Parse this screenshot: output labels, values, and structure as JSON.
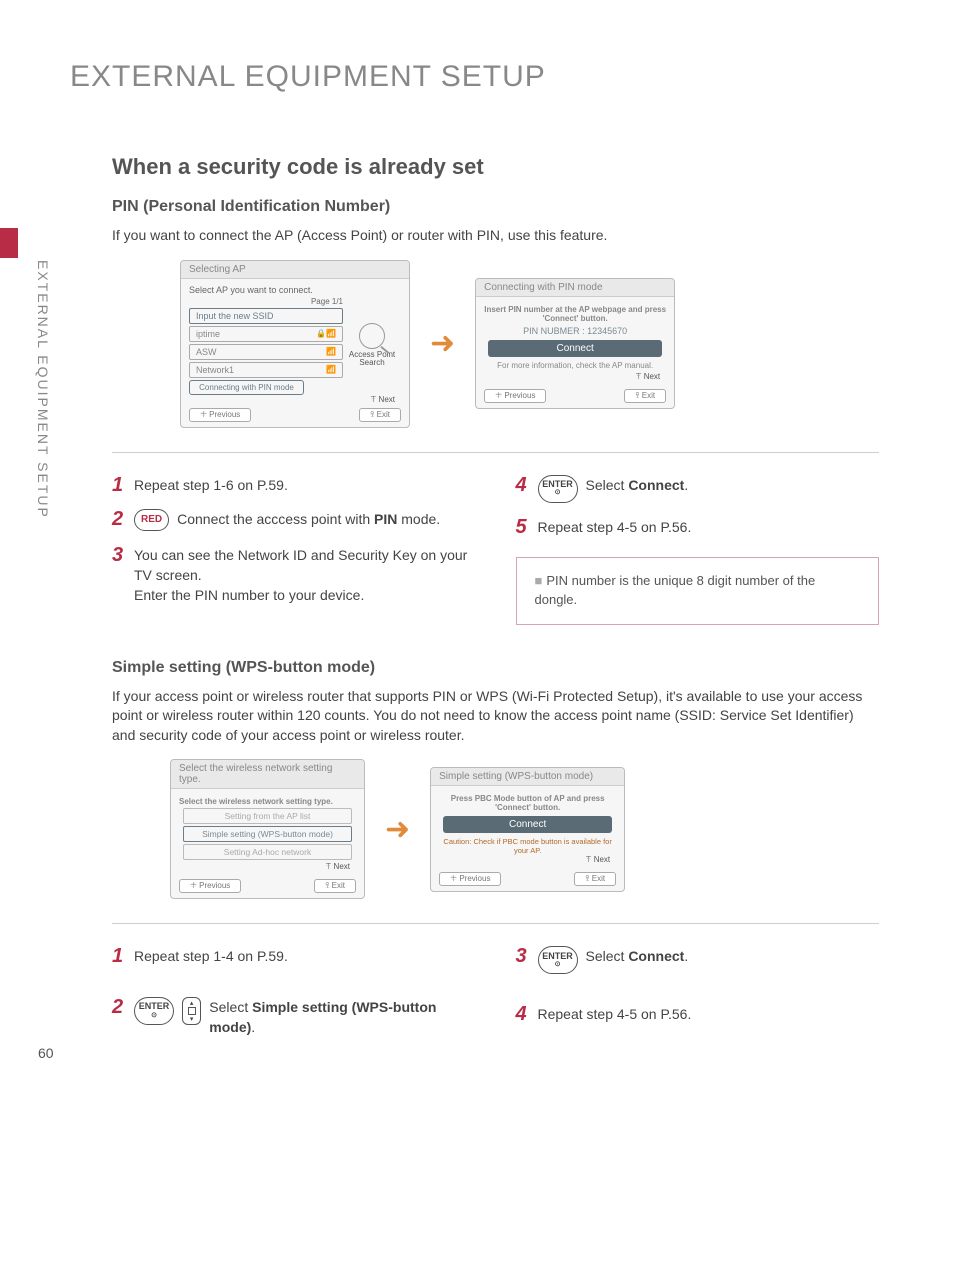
{
  "accentColor": "#b82c45",
  "sideLabel": "EXTERNAL EQUIPMENT SETUP",
  "pageNumber": "60",
  "mainTitle": "EXTERNAL EQUIPMENT SETUP",
  "section1": {
    "heading": "When a security code is already set",
    "sub": "PIN (Personal Identification Number)",
    "intro": "If you want to connect the AP (Access Point) or router with PIN, use this feature."
  },
  "selectingPanel": {
    "title": "Selecting AP",
    "sub": "Select AP you want to connect.",
    "page": "Page 1/1",
    "inputSsid": "Input the new SSID",
    "ap1": "iptime",
    "ap2": "ASW",
    "ap3": "Network1",
    "pinModeBtn": "Connecting with PIN mode",
    "searchLbl": "Access Point Search",
    "next": "ꔉ Next",
    "previous": "ꔰ Previous",
    "exit": "ꕉ Exit"
  },
  "connectingPanel": {
    "title": "Connecting with PIN mode",
    "sub1": "Insert PIN number at the AP webpage and press 'Connect' button.",
    "pinLabel": "PIN NUBMER : 12345670",
    "connect": "Connect",
    "info": "For more information, check the AP manual.",
    "next": "ꔉ Next",
    "previous": "ꔰ Previous",
    "exit": "ꕉ Exit"
  },
  "steps1Left": {
    "s1": "Repeat step 1-6 on P.59.",
    "s2": "Connect the acccess point with ",
    "s2bold": "PIN",
    "s2cont": " mode.",
    "s3a": "You can see the Network ID and Security Key on your TV screen.",
    "s3b": "Enter the PIN number to your device.",
    "redLabel": "RED"
  },
  "steps1Right": {
    "enterLabel": "ENTER",
    "s4": "Select ",
    "s4bold": "Connect",
    "s5": "Repeat step 4-5 on P.56.",
    "note": "PIN number is the unique 8 digit number of the dongle."
  },
  "section2": {
    "heading": "Simple setting (WPS-button mode)",
    "intro": "If your access point or wireless router that supports PIN or WPS (Wi-Fi Protected Setup), it's available to use your access point or wireless router within 120 counts. You do not need to know the access point name (SSID: Service Set Identifier) and security code of your access point or wireless router."
  },
  "typePanel": {
    "title": "Select the wireless network setting type.",
    "sub": "Select the wireless network setting type.",
    "opt1": "Setting from the AP list",
    "opt2": "Simple setting (WPS-button mode)",
    "opt3": "Setting Ad-hoc network",
    "next": "ꔉ Next",
    "previous": "ꔰ Previous",
    "exit": "ꕉ Exit"
  },
  "wpsPanel": {
    "title": "Simple setting (WPS-button mode)",
    "sub": "Press PBC Mode button of AP and press 'Connect' button.",
    "connect": "Connect",
    "caution": "Caution: Check if PBC mode button is available for your AP.",
    "next": "ꔉ Next",
    "previous": "ꔰ Previous",
    "exit": "ꕉ Exit"
  },
  "steps2Left": {
    "s1": "Repeat step 1-4 on P.59.",
    "s2": "Select ",
    "s2bold": "Simple setting (WPS-button mode)",
    "enterLabel": "ENTER"
  },
  "steps2Right": {
    "s3": "Select ",
    "s3bold": "Connect",
    "s4": "Repeat step 4-5 on P.56.",
    "enterLabel": "ENTER"
  }
}
